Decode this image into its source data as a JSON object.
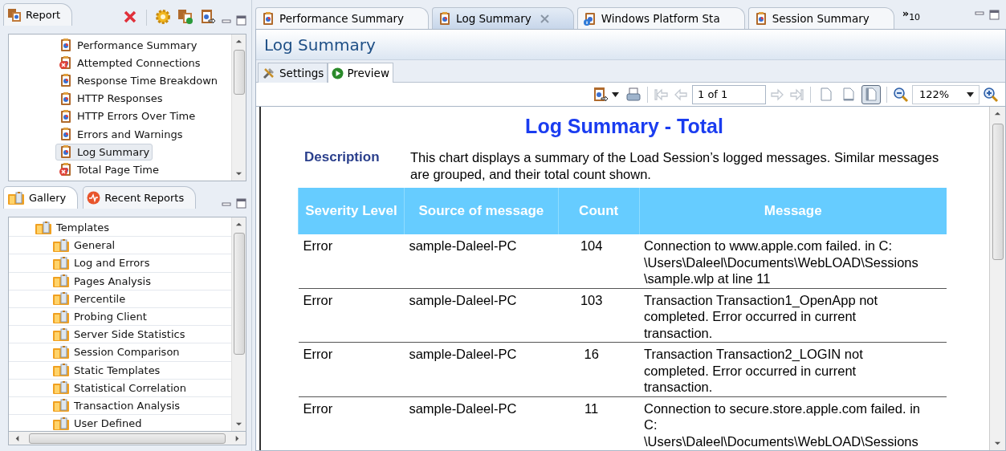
{
  "report_panel": {
    "tab": "Report",
    "items": [
      {
        "label": "Performance Summary",
        "kind": "report",
        "selected": false
      },
      {
        "label": "Attempted Connections",
        "kind": "failed",
        "selected": false
      },
      {
        "label": "Response Time Breakdown",
        "kind": "report",
        "selected": false
      },
      {
        "label": "HTTP Responses",
        "kind": "report",
        "selected": false
      },
      {
        "label": "HTTP Errors Over Time",
        "kind": "report",
        "selected": false
      },
      {
        "label": "Errors and Warnings",
        "kind": "report",
        "selected": false
      },
      {
        "label": "Log Summary",
        "kind": "report",
        "selected": true
      },
      {
        "label": "Total Page Time",
        "kind": "failed",
        "selected": false
      }
    ]
  },
  "gallery_panel": {
    "tabs": [
      {
        "label": "Gallery",
        "kind": "gallery",
        "selected": true
      },
      {
        "label": "Recent Reports",
        "kind": "recent",
        "selected": false
      }
    ],
    "tree": [
      {
        "label": "Templates",
        "children": [
          {
            "label": "General"
          },
          {
            "label": "Log and Errors"
          },
          {
            "label": "Pages Analysis"
          },
          {
            "label": "Percentile"
          },
          {
            "label": "Probing Client"
          },
          {
            "label": "Server Side Statistics"
          },
          {
            "label": "Session Comparison"
          },
          {
            "label": "Static Templates"
          },
          {
            "label": "Statistical Correlation"
          },
          {
            "label": "Transaction Analysis"
          },
          {
            "label": "User Defined"
          }
        ]
      }
    ]
  },
  "editor_tabs": {
    "tabs": [
      {
        "label": "Performance Summary",
        "kind": "report",
        "selected": false
      },
      {
        "label": "Log Summary",
        "kind": "report",
        "selected": true
      },
      {
        "label": "Windows Platform Sta",
        "kind": "info",
        "selected": false
      },
      {
        "label": "Session Summary",
        "kind": "report",
        "selected": false
      }
    ],
    "overflow_mark": "»",
    "overflow_count": "10"
  },
  "editor": {
    "title": "Log Summary",
    "subtabs": [
      {
        "label": "Settings",
        "kind": "settings",
        "selected": false
      },
      {
        "label": "Preview",
        "kind": "preview",
        "selected": true
      }
    ],
    "toolbar": {
      "nav_buttons": [
        {
          "kind": "first",
          "disabled": true
        },
        {
          "kind": "prev",
          "disabled": true
        }
      ],
      "page": "1 of 1",
      "nav_buttons_after": [
        {
          "kind": "next",
          "disabled": true
        },
        {
          "kind": "last",
          "disabled": true
        }
      ],
      "layout_buttons": [
        {
          "selected": false
        },
        {
          "selected": false
        },
        {
          "selected": true
        }
      ],
      "zoom": "122%"
    },
    "report": {
      "title": "Log Summary - Total",
      "description_label": "Description",
      "description": "This chart displays a summary of the Load Session’s logged messages. Similar messages are grouped, and their total count shown.",
      "columns": [
        "Severity Level",
        "Source of message",
        "Count",
        "Message"
      ],
      "rows": [
        [
          "Error",
          "sample-Daleel-PC",
          "104",
          "Connection to www.apple.com failed. in C: \\Users\\Daleel\\Documents\\WebLOAD\\Sessions \\sample.wlp at line 11"
        ],
        [
          "Error",
          "sample-Daleel-PC",
          "103",
          "Transaction Transaction1_OpenApp not completed. Error occurred in current transaction."
        ],
        [
          "Error",
          "sample-Daleel-PC",
          "16",
          "Transaction Transaction2_LOGIN not completed. Error occurred in current transaction."
        ],
        [
          "Error",
          "sample-Daleel-PC",
          "11",
          "Connection to secure.store.apple.com failed. in C: \\Users\\Daleel\\Documents\\WebLOAD\\Sessions"
        ]
      ]
    }
  }
}
